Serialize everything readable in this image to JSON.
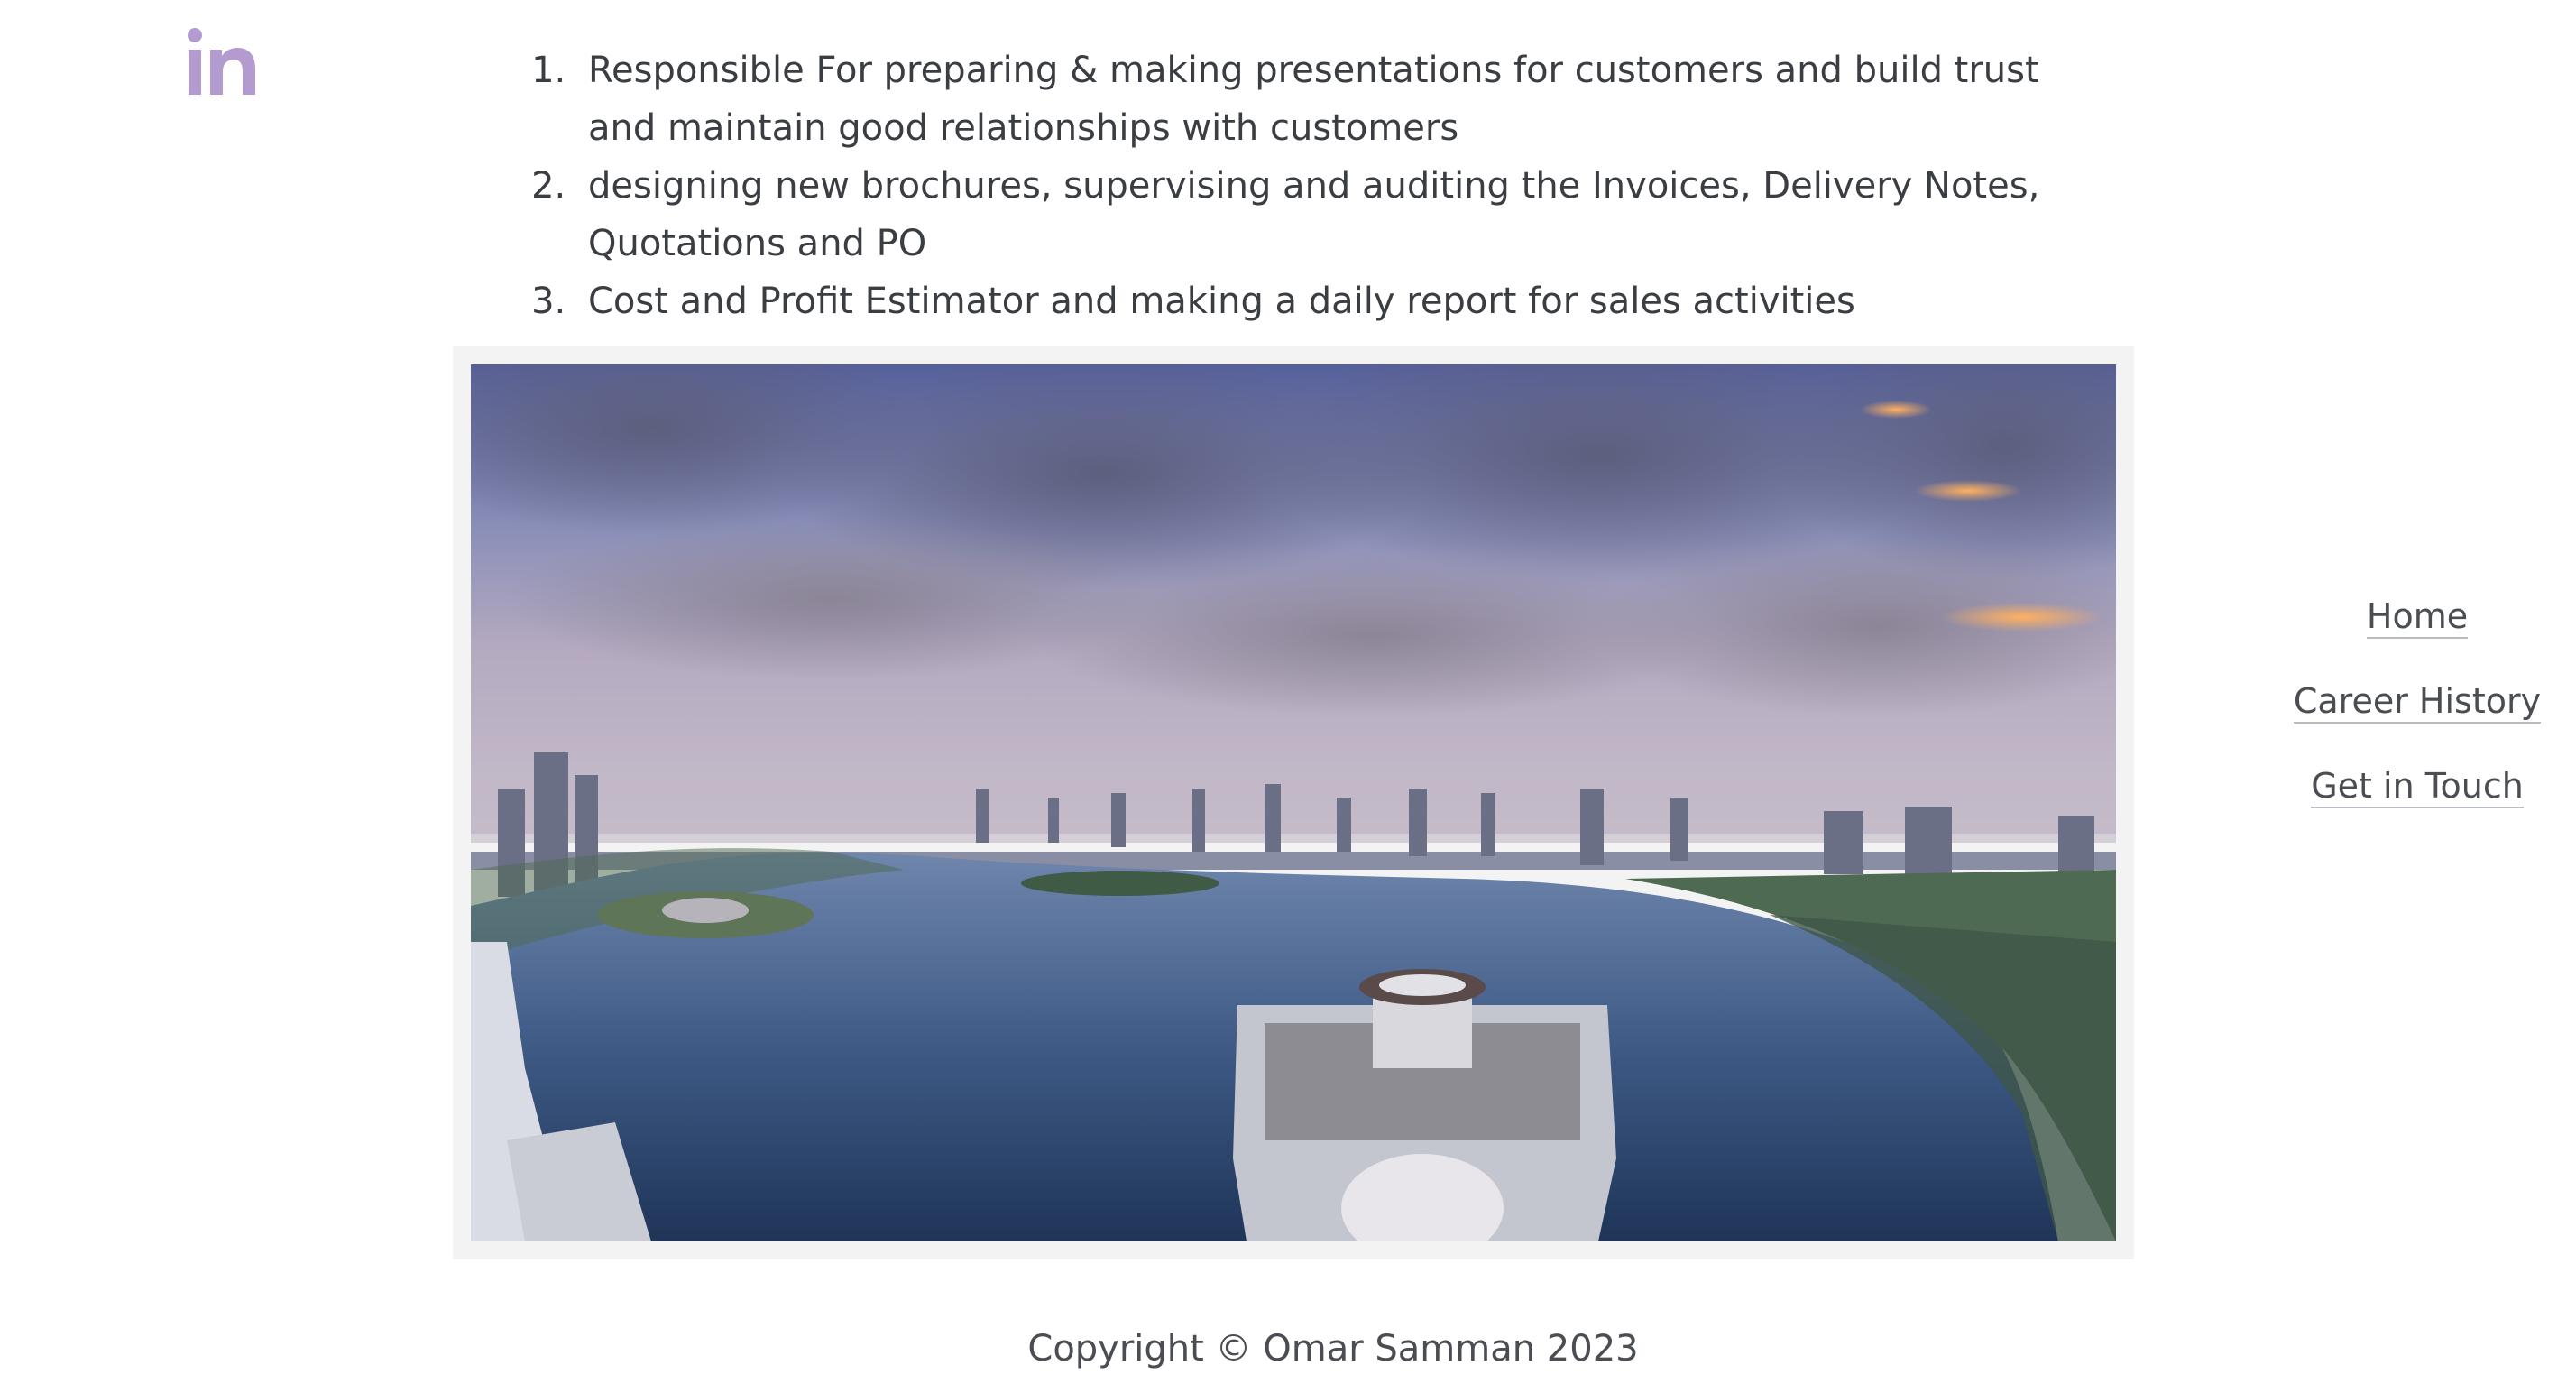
{
  "brand": {
    "icon": "linkedin-icon",
    "accent": "#b39bd0"
  },
  "duties": [
    "Responsible For preparing & making presentations for customers and build trust and maintain good relationships with customers",
    "designing new brochures, supervising and auditing the Invoices, Delivery Notes, Quotations and PO",
    "Cost and Profit Estimator and making a daily report for sales activities"
  ],
  "nav": {
    "home": "Home",
    "career": "Career History",
    "contact": "Get in Touch"
  },
  "footer": {
    "copyright": "Copyright © Omar Samman 2023"
  }
}
